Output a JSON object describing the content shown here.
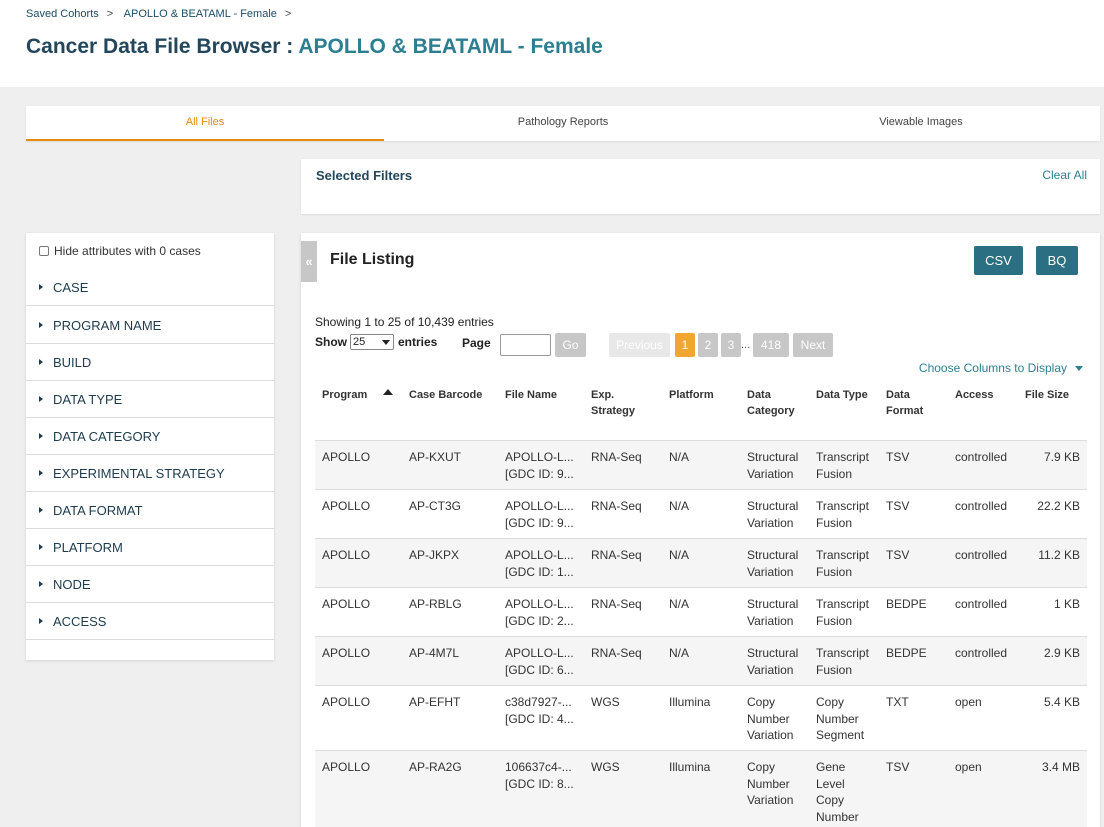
{
  "breadcrumb": [
    "Saved Cohorts",
    "APOLLO & BEATAML - Female"
  ],
  "breadcrumb_sep": ">",
  "title": {
    "prefix": "Cancer Data File Browser : ",
    "cohort": "APOLLO & BEATAML - Female"
  },
  "tabs": [
    "All Files",
    "Pathology Reports",
    "Viewable Images"
  ],
  "filters": {
    "title": "Selected Filters",
    "clear_all": "Clear All"
  },
  "sidebar": {
    "hide_attrs": "Hide attributes with 0 cases",
    "facets": [
      "CASE",
      "PROGRAM NAME",
      "BUILD",
      "DATA TYPE",
      "DATA CATEGORY",
      "EXPERIMENTAL STRATEGY",
      "DATA FORMAT",
      "PLATFORM",
      "NODE",
      "ACCESS"
    ]
  },
  "listing": {
    "collapse_icon": "«",
    "title": "File Listing",
    "csv": "CSV",
    "bq": "BQ",
    "showing": "Showing 1 to 25 of 10,439 entries",
    "show_label": "Show",
    "page_size": "25",
    "entries_label": "entries",
    "page_label": "Page",
    "go": "Go",
    "pagination": {
      "previous": "Previous",
      "pages": [
        "1",
        "2",
        "3"
      ],
      "ellipsis": "...",
      "last": "418",
      "next": "Next"
    },
    "choose_columns": "Choose Columns to Display"
  },
  "table": {
    "columns": [
      "Program",
      "Case Barcode",
      "File Name",
      "Exp.\nStrategy",
      "Platform",
      "Data\nCategory",
      "Data Type",
      "Data\nFormat",
      "Access",
      "File Size"
    ],
    "rows": [
      {
        "program": "APOLLO",
        "case": "AP-KXUT",
        "file1": "APOLLO-L...",
        "file2": "[GDC ID: 9...",
        "strategy": "RNA-Seq",
        "platform": "N/A",
        "category": [
          "Structural",
          "Variation"
        ],
        "dtype": [
          "Transcript",
          "Fusion"
        ],
        "format": "TSV",
        "access": "controlled",
        "size": "7.9 KB"
      },
      {
        "program": "APOLLO",
        "case": "AP-CT3G",
        "file1": "APOLLO-L...",
        "file2": "[GDC ID: 9...",
        "strategy": "RNA-Seq",
        "platform": "N/A",
        "category": [
          "Structural",
          "Variation"
        ],
        "dtype": [
          "Transcript",
          "Fusion"
        ],
        "format": "TSV",
        "access": "controlled",
        "size": "22.2 KB"
      },
      {
        "program": "APOLLO",
        "case": "AP-JKPX",
        "file1": "APOLLO-L...",
        "file2": "[GDC ID: 1...",
        "strategy": "RNA-Seq",
        "platform": "N/A",
        "category": [
          "Structural",
          "Variation"
        ],
        "dtype": [
          "Transcript",
          "Fusion"
        ],
        "format": "TSV",
        "access": "controlled",
        "size": "11.2 KB"
      },
      {
        "program": "APOLLO",
        "case": "AP-RBLG",
        "file1": "APOLLO-L...",
        "file2": "[GDC ID: 2...",
        "strategy": "RNA-Seq",
        "platform": "N/A",
        "category": [
          "Structural",
          "Variation"
        ],
        "dtype": [
          "Transcript",
          "Fusion"
        ],
        "format": "BEDPE",
        "access": "controlled",
        "size": "1 KB"
      },
      {
        "program": "APOLLO",
        "case": "AP-4M7L",
        "file1": "APOLLO-L...",
        "file2": "[GDC ID: 6...",
        "strategy": "RNA-Seq",
        "platform": "N/A",
        "category": [
          "Structural",
          "Variation"
        ],
        "dtype": [
          "Transcript",
          "Fusion"
        ],
        "format": "BEDPE",
        "access": "controlled",
        "size": "2.9 KB"
      },
      {
        "program": "APOLLO",
        "case": "AP-EFHT",
        "file1": "c38d7927-...",
        "file2": "[GDC ID: 4...",
        "strategy": "WGS",
        "platform": "Illumina",
        "category": [
          "Copy",
          "Number",
          "Variation"
        ],
        "dtype": [
          "Copy",
          "Number",
          "Segment"
        ],
        "format": "TXT",
        "access": "open",
        "size": "5.4 KB"
      },
      {
        "program": "APOLLO",
        "case": "AP-RA2G",
        "file1": "106637c4-...",
        "file2": "[GDC ID: 8...",
        "strategy": "WGS",
        "platform": "Illumina",
        "category": [
          "Copy",
          "Number",
          "Variation"
        ],
        "dtype": [
          "Gene",
          "Level",
          "Copy",
          "Number"
        ],
        "format": "TSV",
        "access": "open",
        "size": "3.4 MB"
      }
    ]
  }
}
